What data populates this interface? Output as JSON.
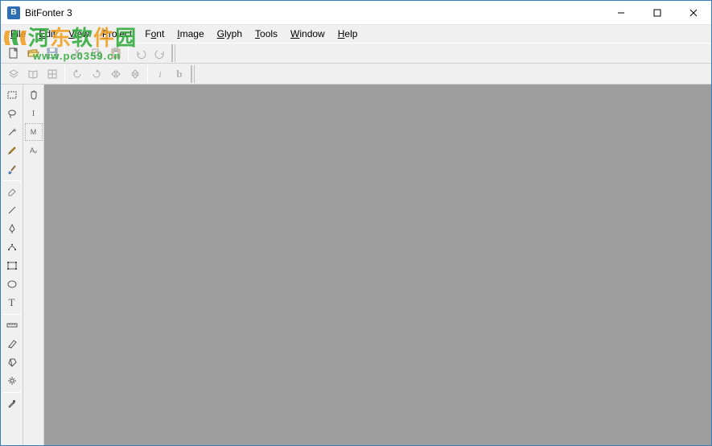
{
  "titlebar": {
    "title": "BitFonter 3",
    "app_icon_letter": "B"
  },
  "menu": {
    "file": {
      "label": "File",
      "accel": "F"
    },
    "edit": {
      "label": "Edit",
      "accel": "E"
    },
    "view": {
      "label": "View",
      "accel": "V"
    },
    "project": {
      "label": "Project",
      "accel": "P"
    },
    "font": {
      "label": "Font",
      "accel": "o"
    },
    "image": {
      "label": "Image",
      "accel": "I"
    },
    "glyph": {
      "label": "Glyph",
      "accel": "G"
    },
    "tools": {
      "label": "Tools",
      "accel": "T"
    },
    "window": {
      "label": "Window",
      "accel": "W"
    },
    "help": {
      "label": "Help",
      "accel": "H"
    }
  },
  "toolbar1": {
    "new": {
      "name": "new",
      "enabled": true
    },
    "open": {
      "name": "open",
      "enabled": true
    },
    "save": {
      "name": "save",
      "enabled": false
    },
    "cut": {
      "name": "cut",
      "enabled": false
    },
    "copy": {
      "name": "copy",
      "enabled": false
    },
    "paste": {
      "name": "paste",
      "enabled": false
    },
    "undo": {
      "name": "undo",
      "enabled": false
    },
    "redo": {
      "name": "redo",
      "enabled": false
    }
  },
  "toolbar2": {
    "layers": {
      "name": "layers",
      "enabled": false
    },
    "book": {
      "name": "book",
      "enabled": false
    },
    "grid": {
      "name": "grid",
      "enabled": false
    },
    "rotate_ccw": {
      "name": "rotate-ccw",
      "enabled": false
    },
    "rotate_cw": {
      "name": "rotate-cw",
      "enabled": false
    },
    "flip_h": {
      "name": "flip-h",
      "enabled": false
    },
    "flip_v": {
      "name": "flip-v",
      "enabled": false
    },
    "info": {
      "name": "info",
      "enabled": false,
      "label": "i"
    },
    "bold": {
      "name": "bold",
      "enabled": false,
      "label": "b"
    }
  },
  "left_tools": [
    "select-rect",
    "lasso",
    "magic-wand",
    "pencil",
    "brush",
    "_sep_",
    "eraser",
    "line",
    "pen",
    "node-edit",
    "shape",
    "rounded-rect",
    "text",
    "_sep_",
    "measure",
    "gradient",
    "smudge",
    "fx",
    "_sep_",
    "eyedropper"
  ],
  "second_col": [
    {
      "name": "hand",
      "label": "✋"
    },
    {
      "name": "type",
      "label": "I"
    },
    {
      "name": "metrics",
      "label": "M"
    },
    {
      "name": "kerning",
      "label": "Aᵥ"
    }
  ],
  "watermark": {
    "line1": "河东软件园",
    "line2": "www.pc0359.cn"
  },
  "colors": {
    "canvas": "#9e9e9e",
    "panel": "#f0f0f0",
    "border": "#d0d0d0"
  }
}
